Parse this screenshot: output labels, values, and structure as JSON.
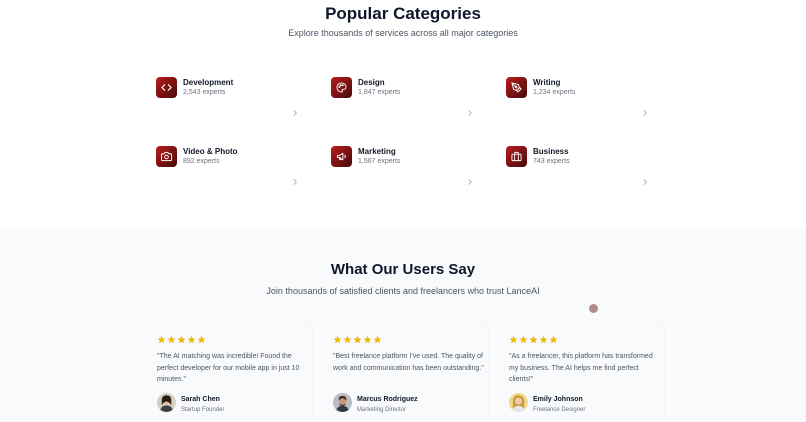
{
  "categories_section": {
    "title": "Popular Categories",
    "subtitle": "Explore thousands of services across all major categories",
    "items": [
      {
        "name": "Development",
        "count": "2,543 experts",
        "icon": "code-icon"
      },
      {
        "name": "Design",
        "count": "1,847 experts",
        "icon": "palette-icon"
      },
      {
        "name": "Writing",
        "count": "1,234 experts",
        "icon": "pen-tool-icon"
      },
      {
        "name": "Video & Photo",
        "count": "892 experts",
        "icon": "camera-icon"
      },
      {
        "name": "Marketing",
        "count": "1,567 experts",
        "icon": "megaphone-icon"
      },
      {
        "name": "Business",
        "count": "743 experts",
        "icon": "briefcase-icon"
      }
    ],
    "accent_color": "#b91c1c"
  },
  "testimonials_section": {
    "title": "What Our Users Say",
    "subtitle": "Join thousands of satisfied clients and freelancers who trust LanceAI",
    "star_color": "#f5b800",
    "items": [
      {
        "rating": 5,
        "quote": "\"The AI matching was incredible! Found the perfect developer for our mobile app in just 10 minutes.\"",
        "name": "Sarah Chen",
        "role": "Startup Founder"
      },
      {
        "rating": 5,
        "quote": "\"Best freelance platform I've used. The quality of work and communication has been outstanding.\"",
        "name": "Marcus Rodriguez",
        "role": "Marketing Director"
      },
      {
        "rating": 5,
        "quote": "\"As a freelancer, this platform has transformed my business. The AI helps me find perfect clients!\"",
        "name": "Emily Johnson",
        "role": "Freelance Designer"
      }
    ]
  }
}
